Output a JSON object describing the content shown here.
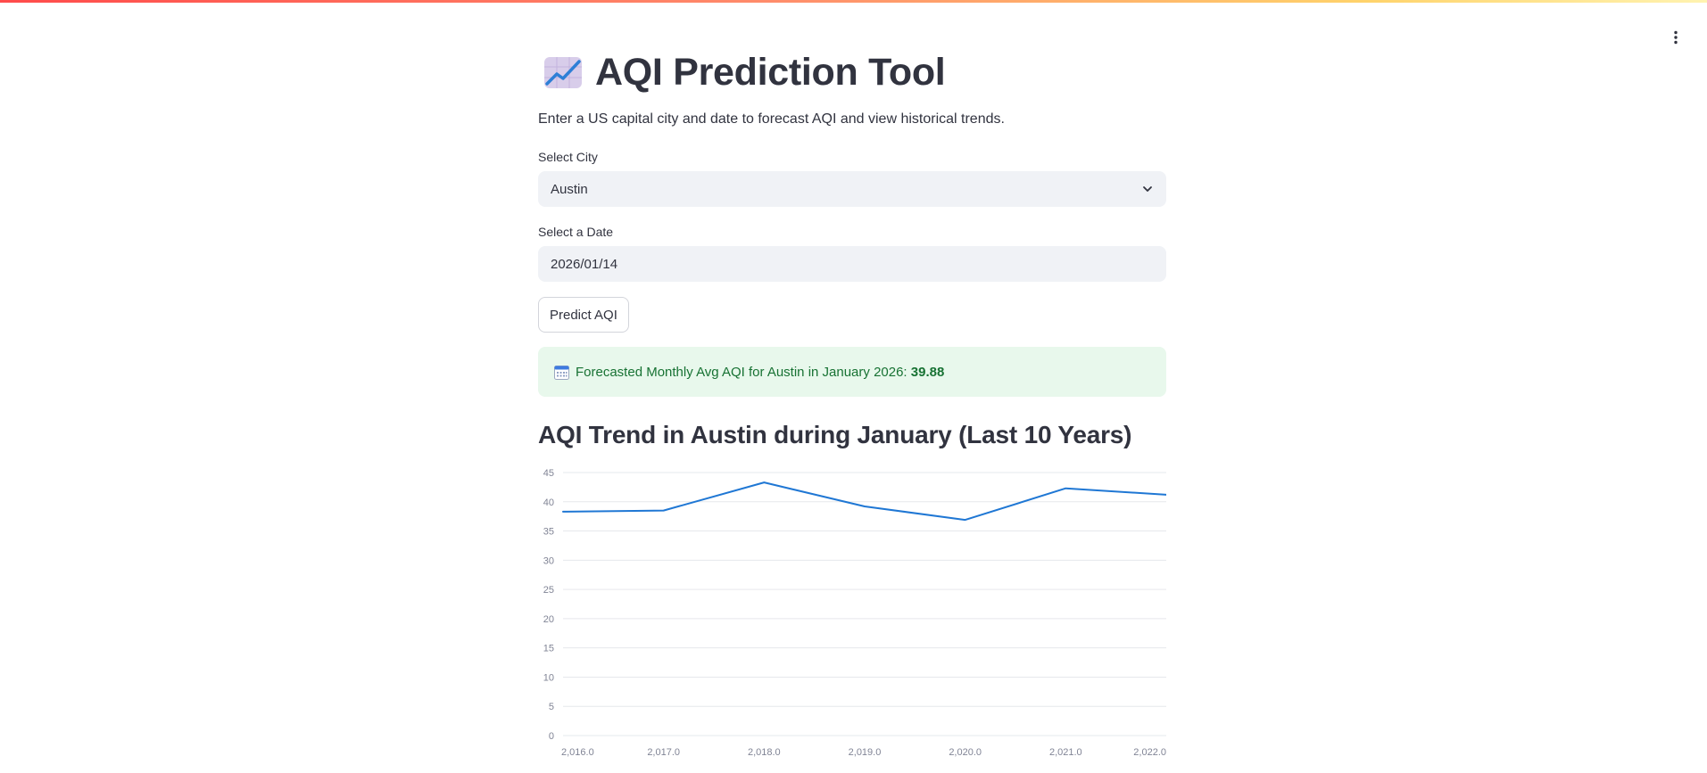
{
  "app": {
    "title": "AQI Prediction Tool",
    "title_icon": "chart-increasing-icon",
    "subtitle": "Enter a US capital city and date to forecast AQI and view historical trends."
  },
  "colors": {
    "accent_line": "#1f77d4",
    "success_bg": "#e8f8ec",
    "success_text": "#177233",
    "input_bg": "#f0f2f6"
  },
  "form": {
    "city_label": "Select City",
    "city_value": "Austin",
    "date_label": "Select a Date",
    "date_value": "2026/01/14",
    "predict_button": "Predict AQI"
  },
  "result": {
    "icon": "calendar-icon",
    "text": "Forecasted Monthly Avg AQI for Austin in January 2026: ",
    "value": "39.88"
  },
  "chart_section": {
    "title": "AQI Trend in Austin during January (Last 10 Years)"
  },
  "chart_data": {
    "type": "line",
    "title": "",
    "xlabel": "",
    "ylabel": "",
    "x": [
      2016,
      2017,
      2018,
      2019,
      2020,
      2021,
      2022
    ],
    "x_tick_labels": [
      "2,016.0",
      "2,017.0",
      "2,018.0",
      "2,019.0",
      "2,020.0",
      "2,021.0",
      "2,022.0"
    ],
    "y_ticks": [
      0,
      5,
      10,
      15,
      20,
      25,
      30,
      35,
      40,
      45
    ],
    "ylim": [
      0,
      45
    ],
    "grid": true,
    "series": [
      {
        "values": [
          38.3,
          38.5,
          43.3,
          39.2,
          36.9,
          42.3,
          41.2
        ]
      }
    ]
  }
}
